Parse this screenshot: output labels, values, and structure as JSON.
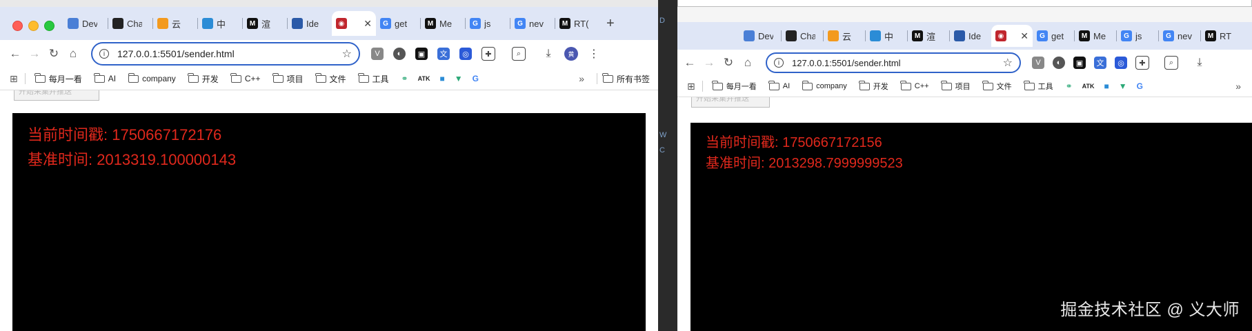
{
  "left": {
    "tabs": [
      {
        "label": "Dev",
        "icon": "vuejs-icon",
        "color": "#4a7fd6"
      },
      {
        "label": "Cha",
        "icon": "chatgpt-icon",
        "color": "#222222"
      },
      {
        "label": "云",
        "icon": "doc-icon",
        "color": "#f39a1e"
      },
      {
        "label": "中",
        "icon": "chinese-site-icon",
        "color": "#2b8cd6"
      },
      {
        "label": "渲",
        "icon": "medium-icon",
        "color": "#111111"
      },
      {
        "label": "Ide",
        "icon": "w3c-icon",
        "color": "#2b5aa8"
      },
      {
        "label": "",
        "icon": "record-icon",
        "color": "#c0262d",
        "active": true
      },
      {
        "label": "get",
        "icon": "google-icon",
        "color": "#4285f4"
      },
      {
        "label": "Me",
        "icon": "medium-icon",
        "color": "#111111"
      },
      {
        "label": "js",
        "icon": "google-icon",
        "color": "#4285f4"
      },
      {
        "label": "nev",
        "icon": "google-icon",
        "color": "#4285f4"
      },
      {
        "label": "RT(",
        "icon": "medium-icon",
        "color": "#111111"
      }
    ],
    "url": "127.0.0.1:5501/sender.html",
    "bookmarks": [
      "每月一看",
      "AI",
      "company",
      "开发",
      "C++",
      "项目",
      "文件",
      "工具"
    ],
    "all_bookmarks": "所有书签",
    "page_button": "开始采集并推送",
    "timestamp_line": "当前时间戳: 1750667172176",
    "base_line": "基准时间: 2013319.100000143"
  },
  "right": {
    "tabs": [
      {
        "label": "Dev",
        "icon": "vuejs-icon",
        "color": "#4a7fd6"
      },
      {
        "label": "Cha",
        "icon": "chatgpt-icon",
        "color": "#222222"
      },
      {
        "label": "云",
        "icon": "doc-icon",
        "color": "#f39a1e"
      },
      {
        "label": "中",
        "icon": "chinese-site-icon",
        "color": "#2b8cd6"
      },
      {
        "label": "渲",
        "icon": "medium-icon",
        "color": "#111111"
      },
      {
        "label": "Ide",
        "icon": "w3c-icon",
        "color": "#2b5aa8"
      },
      {
        "label": "",
        "icon": "record-icon",
        "color": "#c0262d",
        "active": true
      },
      {
        "label": "get",
        "icon": "google-icon",
        "color": "#4285f4"
      },
      {
        "label": "Me",
        "icon": "medium-icon",
        "color": "#111111"
      },
      {
        "label": "js",
        "icon": "google-icon",
        "color": "#4285f4"
      },
      {
        "label": "nev",
        "icon": "google-icon",
        "color": "#4285f4"
      },
      {
        "label": "RT",
        "icon": "medium-icon",
        "color": "#111111"
      }
    ],
    "url": "127.0.0.1:5501/sender.html",
    "bookmarks": [
      "每月一看",
      "AI",
      "company",
      "开发",
      "C++",
      "项目",
      "文件",
      "工具"
    ],
    "page_button": "开始采集并推送",
    "timestamp_line": "当前时间戳: 1750667172156",
    "base_line": "基准时间: 2013298.7999999523"
  },
  "watermark": "掘金技术社区 @ 义大师",
  "colors": {
    "text_red": "#e0281c",
    "accent_blue": "#2f62c9"
  }
}
